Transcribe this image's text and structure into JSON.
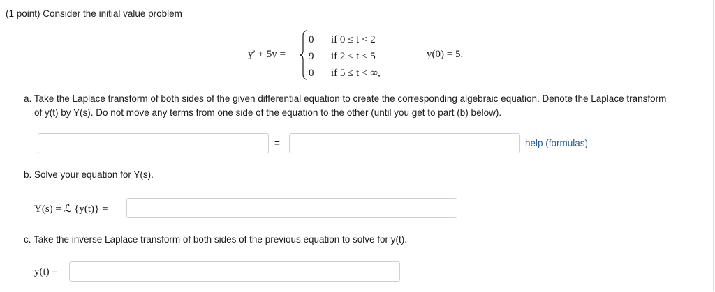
{
  "problem": {
    "header": "(1 point) Consider the initial value problem",
    "equation_lhs": "y′ + 5y =",
    "cases": [
      {
        "value": "0",
        "condition": "if 0 ≤ t < 2"
      },
      {
        "value": "9",
        "condition": "if 2 ≤ t < 5"
      },
      {
        "value": "0",
        "condition": "if 5 ≤ t < ∞,"
      }
    ],
    "initial_condition": "y(0) = 5."
  },
  "part_a": {
    "line1": "a. Take the Laplace transform of both sides of the given differential equation to create the corresponding algebraic equation. Denote the Laplace transform",
    "line2": "of y(t) by Y(s). Do not move any terms from one side of the equation to the other (until you get to part (b) below).",
    "left_input_value": "",
    "equals": "=",
    "right_input_value": "",
    "help_link": "help (formulas)"
  },
  "part_b": {
    "prompt": "b. Solve your equation for Y(s).",
    "label": "Y(s) = ℒ {y(t)} =",
    "input_value": ""
  },
  "part_c": {
    "prompt": "c. Take the inverse Laplace transform of both sides of the previous equation to solve for y(t).",
    "label": "y(t) =",
    "input_value": ""
  }
}
